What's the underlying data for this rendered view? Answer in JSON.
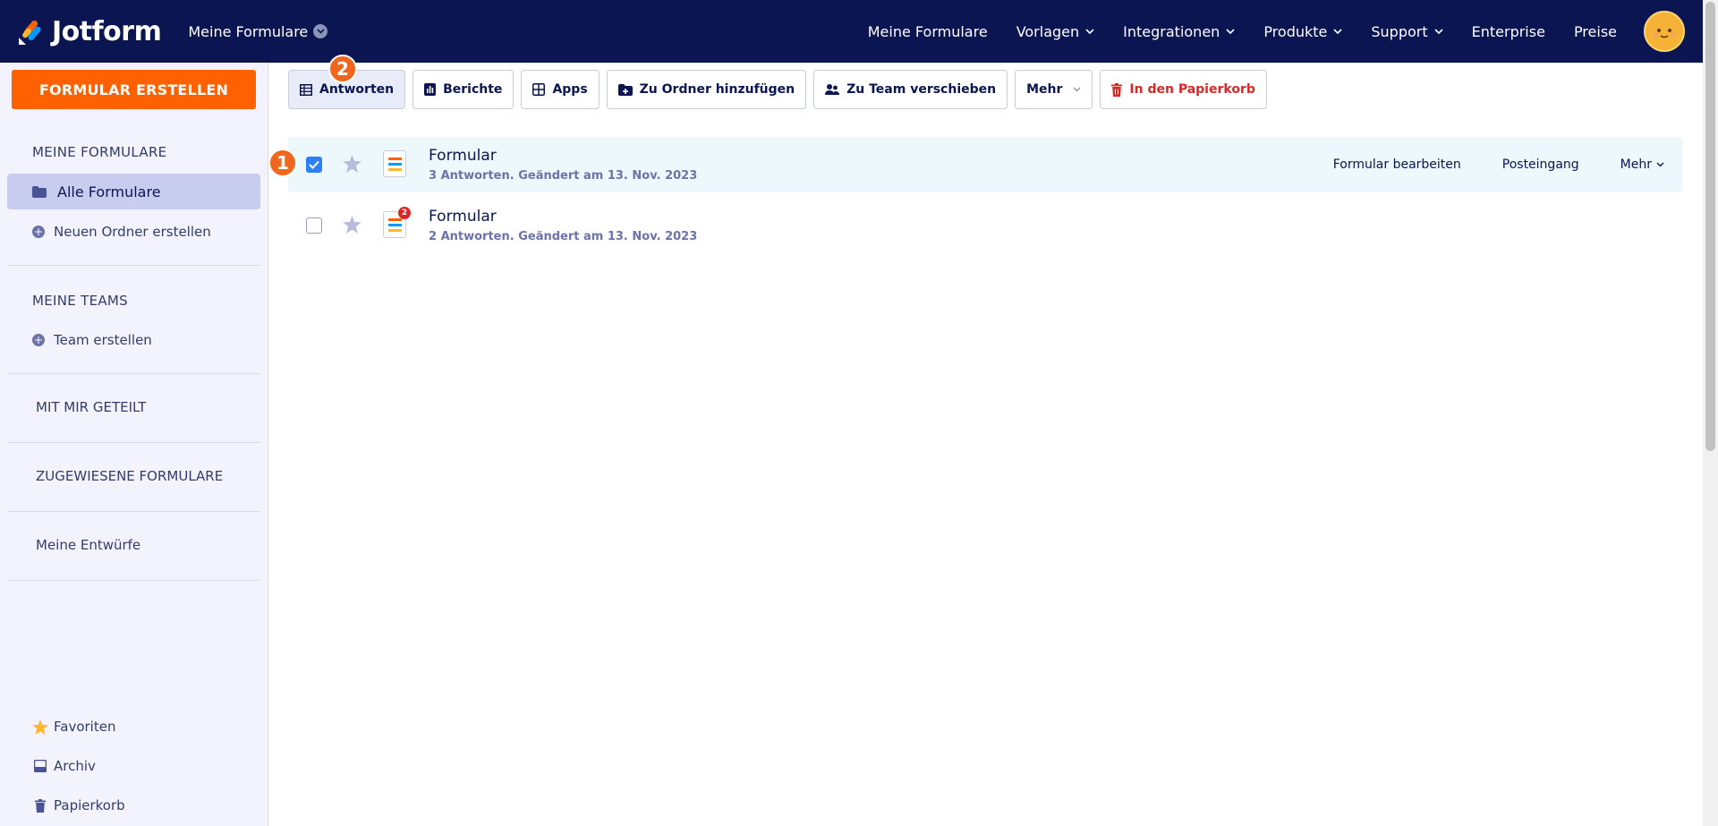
{
  "app": {
    "name": "Jotform",
    "workspace_switch": "Meine Formulare"
  },
  "topnav": [
    {
      "label": "Meine Formulare",
      "dropdown": false
    },
    {
      "label": "Vorlagen",
      "dropdown": true
    },
    {
      "label": "Integrationen",
      "dropdown": true
    },
    {
      "label": "Produkte",
      "dropdown": true
    },
    {
      "label": "Support",
      "dropdown": true
    },
    {
      "label": "Enterprise",
      "dropdown": false
    },
    {
      "label": "Preise",
      "dropdown": false
    }
  ],
  "sidebar": {
    "create_button": "FORMULAR ERSTELLEN",
    "my_forms_title": "MEINE FORMULARE",
    "all_forms": "Alle Formulare",
    "new_folder": "Neuen Ordner erstellen",
    "my_teams_title": "MEINE TEAMS",
    "create_team": "Team erstellen",
    "shared_with_me": "MIT MIR GETEILT",
    "assigned_forms": "ZUGEWIESENE FORMULARE",
    "drafts": "Meine Entwürfe",
    "favorites": "Favoriten",
    "archive": "Archiv",
    "trash": "Papierkorb"
  },
  "toolbar": {
    "responses": "Antworten",
    "reports": "Berichte",
    "apps": "Apps",
    "add_to_folder": "Zu Ordner hinzufügen",
    "move_to_team": "Zu Team verschieben",
    "more": "Mehr",
    "trash": "In den Papierkorb"
  },
  "annotations": {
    "one": "1",
    "two": "2"
  },
  "forms": [
    {
      "title": "Formular",
      "meta": "3 Antworten. Geändert am 13. Nov. 2023",
      "checked": true,
      "badge": ""
    },
    {
      "title": "Formular",
      "meta": "2 Antworten. Geändert am 13. Nov. 2023",
      "checked": false,
      "badge": "2"
    }
  ],
  "row_actions": {
    "edit": "Formular bearbeiten",
    "inbox": "Posteingang",
    "more": "Mehr"
  },
  "colors": {
    "navy": "#0a1551",
    "orange": "#ff6100",
    "danger": "#dc2626",
    "checkbox": "#2d7ef7"
  }
}
